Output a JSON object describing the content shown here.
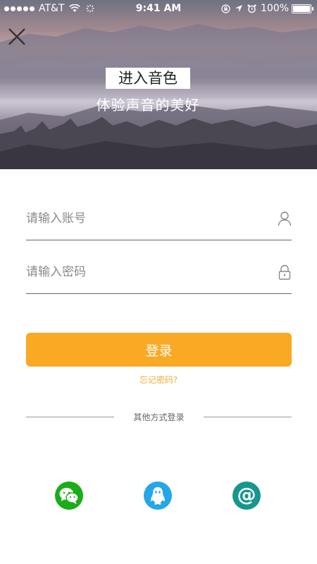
{
  "status_bar": {
    "carrier": "AT&T",
    "time": "9:41 AM",
    "battery": "100%",
    "icons": [
      "signal-dots",
      "wifi-icon",
      "activity-icon",
      "lock-rotation-icon",
      "location-arrow-icon",
      "alarm-icon",
      "battery-icon"
    ]
  },
  "hero": {
    "title": "进入音色",
    "subtitle": "体验声音的美好",
    "close_icon": "close-icon"
  },
  "form": {
    "account_placeholder": "请输入账号",
    "account_value": "",
    "account_icon": "user-icon",
    "password_placeholder": "请输入密码",
    "password_value": "",
    "password_icon": "lock-icon",
    "login_label": "登录",
    "forgot_label": "忘记密码?"
  },
  "other_login": {
    "label": "其他方式登录",
    "options": [
      {
        "name": "wechat",
        "icon": "wechat-icon",
        "color": "#1aad19"
      },
      {
        "name": "qq",
        "icon": "qq-penguin-icon",
        "color": "#24a7e8"
      },
      {
        "name": "email",
        "icon": "at-sign-icon",
        "glyph": "@",
        "color": "#17968f"
      }
    ]
  },
  "colors": {
    "accent": "#f9a923",
    "forgot_link": "#f2b035"
  }
}
